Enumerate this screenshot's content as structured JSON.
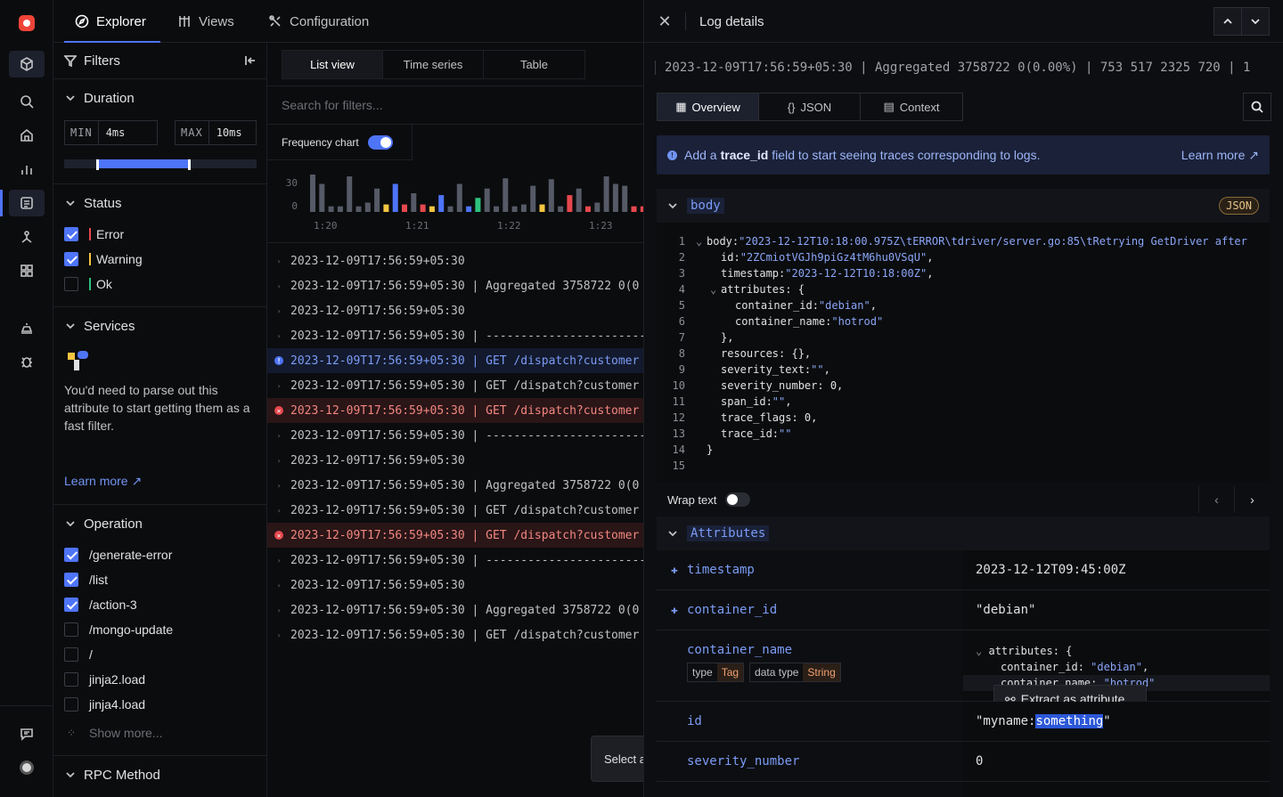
{
  "nav": {
    "tabs": [
      {
        "label": "Explorer",
        "icon": "compass-icon",
        "active": true
      },
      {
        "label": "Views",
        "icon": "views-icon"
      },
      {
        "label": "Configuration",
        "icon": "config-icon"
      }
    ]
  },
  "filters": {
    "title": "Filters",
    "duration": {
      "title": "Duration",
      "min_label": "MIN",
      "min_value": "4ms",
      "max_label": "MAX",
      "max_value": "10ms",
      "range_fraction": [
        0.18,
        0.65
      ]
    },
    "status": {
      "title": "Status",
      "items": [
        {
          "label": "Error",
          "checked": true,
          "color": "#e5484d"
        },
        {
          "label": "Warning",
          "checked": true,
          "color": "#f5c542"
        },
        {
          "label": "Ok",
          "checked": false,
          "color": "#2ec27e"
        }
      ]
    },
    "services": {
      "title": "Services",
      "message": "You'd need to parse out this attribute to start getting them as a fast filter.",
      "learn_more": "Learn more ↗"
    },
    "operation": {
      "title": "Operation",
      "items": [
        {
          "label": "/generate-error",
          "checked": true
        },
        {
          "label": "/list",
          "checked": true
        },
        {
          "label": "/action-3",
          "checked": true
        },
        {
          "label": "/mongo-update",
          "checked": false
        },
        {
          "label": "/",
          "checked": false
        },
        {
          "label": "jinja2.load",
          "checked": false
        },
        {
          "label": "jinja4.load",
          "checked": false
        }
      ],
      "show_more": "Show more..."
    },
    "rpc": {
      "title": "RPC Method"
    }
  },
  "logs": {
    "view_tabs": [
      "List view",
      "Time series",
      "Table"
    ],
    "search_placeholder": "Search for filters...",
    "frequency_label": "Frequency chart",
    "select_tip": "Select a",
    "rows": [
      {
        "text": "2023-12-09T17:56:59+05:30",
        "level": "none"
      },
      {
        "text": "2023-12-09T17:56:59+05:30 | Aggregated 3758722 0(0",
        "level": "none"
      },
      {
        "text": "2023-12-09T17:56:59+05:30",
        "level": "none"
      },
      {
        "text": "2023-12-09T17:56:59+05:30 | ------------------------",
        "level": "none"
      },
      {
        "text": "2023-12-09T17:56:59+05:30 | GET /dispatch?customer",
        "level": "info"
      },
      {
        "text": "2023-12-09T17:56:59+05:30 | GET /dispatch?customer",
        "level": "none"
      },
      {
        "text": "2023-12-09T17:56:59+05:30 | GET /dispatch?customer",
        "level": "error"
      },
      {
        "text": "2023-12-09T17:56:59+05:30 | ------------------------",
        "level": "none"
      },
      {
        "text": "2023-12-09T17:56:59+05:30",
        "level": "none"
      },
      {
        "text": "2023-12-09T17:56:59+05:30 | Aggregated 3758722 0(0",
        "level": "none"
      },
      {
        "text": "2023-12-09T17:56:59+05:30 | GET /dispatch?customer",
        "level": "none"
      },
      {
        "text": "2023-12-09T17:56:59+05:30 | GET /dispatch?customer",
        "level": "error"
      },
      {
        "text": "2023-12-09T17:56:59+05:30 | ------------------------",
        "level": "none"
      },
      {
        "text": "2023-12-09T17:56:59+05:30",
        "level": "none"
      },
      {
        "text": "2023-12-09T17:56:59+05:30 | Aggregated 3758722 0(0",
        "level": "none"
      },
      {
        "text": "2023-12-09T17:56:59+05:30 | GET /dispatch?customer",
        "level": "none"
      }
    ]
  },
  "chart_data": {
    "type": "bar",
    "y_ticks": [
      "30",
      "0"
    ],
    "ylim": [
      0,
      40
    ],
    "x_ticks": [
      "1:20",
      "1:21",
      "1:22",
      "1:23"
    ],
    "series_colors": {
      "info": "#555a66",
      "blue": "#4e74f8",
      "warning": "#f5c542",
      "error": "#e5484d",
      "ok": "#2ec27e"
    },
    "bars": [
      {
        "v": 40,
        "c": "info"
      },
      {
        "v": 30,
        "c": "info"
      },
      {
        "v": 6,
        "c": "info"
      },
      {
        "v": 6,
        "c": "info"
      },
      {
        "v": 38,
        "c": "info"
      },
      {
        "v": 6,
        "c": "info"
      },
      {
        "v": 10,
        "c": "info"
      },
      {
        "v": 25,
        "c": "info"
      },
      {
        "v": 8,
        "c": "warning"
      },
      {
        "v": 30,
        "c": "blue"
      },
      {
        "v": 8,
        "c": "error"
      },
      {
        "v": 20,
        "c": "info"
      },
      {
        "v": 8,
        "c": "error"
      },
      {
        "v": 6,
        "c": "warning"
      },
      {
        "v": 18,
        "c": "blue"
      },
      {
        "v": 6,
        "c": "info"
      },
      {
        "v": 30,
        "c": "info"
      },
      {
        "v": 6,
        "c": "blue"
      },
      {
        "v": 15,
        "c": "ok"
      },
      {
        "v": 25,
        "c": "info"
      },
      {
        "v": 6,
        "c": "info"
      },
      {
        "v": 36,
        "c": "info"
      },
      {
        "v": 6,
        "c": "info"
      },
      {
        "v": 8,
        "c": "info"
      },
      {
        "v": 28,
        "c": "info"
      },
      {
        "v": 8,
        "c": "warning"
      },
      {
        "v": 35,
        "c": "info"
      },
      {
        "v": 6,
        "c": "info"
      },
      {
        "v": 18,
        "c": "error"
      },
      {
        "v": 25,
        "c": "info"
      },
      {
        "v": 6,
        "c": "error"
      },
      {
        "v": 10,
        "c": "info"
      },
      {
        "v": 38,
        "c": "info"
      },
      {
        "v": 30,
        "c": "info"
      },
      {
        "v": 28,
        "c": "info"
      },
      {
        "v": 6,
        "c": "error"
      },
      {
        "v": 6,
        "c": "error"
      },
      {
        "v": 28,
        "c": "info"
      },
      {
        "v": 8,
        "c": "info"
      }
    ]
  },
  "drawer": {
    "title": "Log details",
    "summary": "2023-12-09T17:56:59+05:30 | Aggregated 3758722 0(0.00%) | 753 517 2325 720 | 1",
    "tabs": [
      {
        "label": "Overview",
        "icon": "table-icon",
        "active": true
      },
      {
        "label": "JSON",
        "icon": "braces-icon"
      },
      {
        "label": "Context",
        "icon": "context-icon"
      }
    ],
    "banner": {
      "pre": "Add a",
      "field": "trace_id",
      "post": "field to start seeing traces corresponding to logs.",
      "learn_more": "Learn more ↗"
    },
    "body_section": {
      "label": "body",
      "badge": "JSON"
    },
    "code_lines": [
      {
        "n": "1",
        "indent": 0,
        "fold": true,
        "key": "body: ",
        "str": "\"2023-12-12T10:18:00.975Z\\tERROR\\tdriver/server.go:85\\tRetrying GetDriver after",
        "tail": ""
      },
      {
        "n": "2",
        "indent": 1,
        "key": "id: ",
        "str": "\"2ZCmiotVGJh9piGz4tM6hu0VSqU\"",
        "tail": ","
      },
      {
        "n": "3",
        "indent": 1,
        "key": "timestamp: ",
        "str": "\"2023-12-12T10:18:00Z\"",
        "tail": ","
      },
      {
        "n": "4",
        "indent": 1,
        "fold": true,
        "key": "attributes: {",
        "str": "",
        "tail": ""
      },
      {
        "n": "5",
        "indent": 2,
        "key": "container_id: ",
        "str": "\"debian\"",
        "tail": ","
      },
      {
        "n": "6",
        "indent": 2,
        "key": "container_name: ",
        "str": "\"hotrod\"",
        "tail": ""
      },
      {
        "n": "7",
        "indent": 1,
        "key": "},",
        "str": "",
        "tail": ""
      },
      {
        "n": "8",
        "indent": 1,
        "key": "resources: {},",
        "str": "",
        "tail": ""
      },
      {
        "n": "9",
        "indent": 1,
        "key": "severity_text: ",
        "str": "\"\"",
        "tail": ","
      },
      {
        "n": "10",
        "indent": 1,
        "key": "severity_number: 0,",
        "str": "",
        "tail": ""
      },
      {
        "n": "11",
        "indent": 1,
        "key": "span_id: ",
        "str": "\"\"",
        "tail": ","
      },
      {
        "n": "12",
        "indent": 1,
        "key": "trace_flags: 0,",
        "str": "",
        "tail": ""
      },
      {
        "n": "13",
        "indent": 1,
        "key": "trace_id: ",
        "str": "\"\"",
        "tail": ""
      },
      {
        "n": "14",
        "indent": 0,
        "key": "}",
        "str": "",
        "tail": ""
      },
      {
        "n": "15",
        "indent": 0,
        "key": "",
        "str": "",
        "tail": ""
      }
    ],
    "wrap_text": "Wrap text",
    "attributes_section": {
      "label": "Attributes"
    },
    "attributes": {
      "timestamp": {
        "key": "timestamp",
        "value": "2023-12-12T09:45:00Z"
      },
      "container_id": {
        "key": "container_id",
        "value": "\"debian\""
      },
      "container_name": {
        "key": "container_name",
        "type_label": "type",
        "type_value": "Tag",
        "dtype_label": "data type",
        "dtype_value": "String",
        "v1": "attributes: {",
        "v2k": "container_id: ",
        "v2s": "\"debian\"",
        "v2t": ",",
        "v3k": "container_name: ",
        "v3s": "\"hotrod\""
      },
      "id": {
        "key": "id",
        "pre": "\"myname:",
        "highlight": "something",
        "post": "\""
      },
      "severity_number": {
        "key": "severity_number",
        "value": "0"
      }
    },
    "extract_label": "Extract as attribute"
  }
}
